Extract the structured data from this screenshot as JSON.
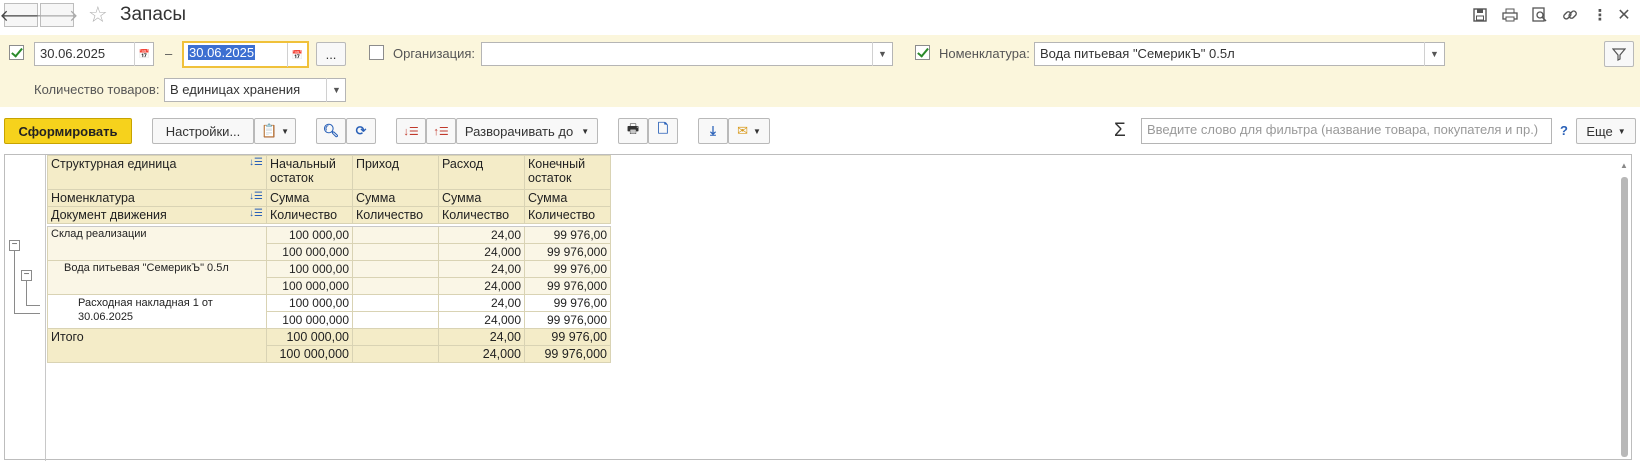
{
  "window": {
    "title": "Запасы",
    "back_icon": "arrow-left-icon",
    "forward_icon": "arrow-right-icon",
    "star_icon": "star-icon"
  },
  "filter": {
    "period_enabled": true,
    "date_from": "30.06.2025",
    "date_to": "30.06.2025",
    "dash": "–",
    "more_label": "...",
    "organization_label": "Организация:",
    "organization_value": "",
    "organization_enabled": false,
    "nomenclature_label": "Номенклатура:",
    "nomenclature_value": "Вода питьевая \"СемерикЪ\" 0.5л",
    "nomenclature_enabled": true,
    "quantity_label": "Количество товаров:",
    "quantity_value": "В единицах хранения"
  },
  "toolbar": {
    "generate_label": "Сформировать",
    "settings_label": "Настройки...",
    "expand_label": "Разворачивать до",
    "sigma": "Σ",
    "search_placeholder": "Введите слово для фильтра (название товара, покупателя и пр.)",
    "help": "?",
    "more_label": "Еще"
  },
  "report": {
    "headers": {
      "col1_row1": "Структурная единица",
      "col1_row2": "Номенклатура",
      "col1_row3": "Документ движения",
      "start_row1": "Начальный остаток",
      "income_row1": "Приход",
      "outcome_row1": "Расход",
      "end_row1": "Конечный остаток",
      "sum": "Сумма",
      "qty": "Количество"
    },
    "rows": [
      {
        "name": "Склад реализации",
        "start_sum": "100 000,00",
        "start_qty": "100 000,000",
        "in_sum": "",
        "in_qty": "",
        "out_sum": "24,00",
        "out_qty": "24,000",
        "end_sum": "99 976,00",
        "end_qty": "99 976,000"
      },
      {
        "name": "Вода питьевая \"СемерикЪ\" 0.5л",
        "start_sum": "100 000,00",
        "start_qty": "100 000,000",
        "in_sum": "",
        "in_qty": "",
        "out_sum": "24,00",
        "out_qty": "24,000",
        "end_sum": "99 976,00",
        "end_qty": "99 976,000"
      },
      {
        "name": "Расходная накладная 1 от",
        "name2": "30.06.2025",
        "start_sum": "100 000,00",
        "start_qty": "100 000,000",
        "in_sum": "",
        "in_qty": "",
        "out_sum": "24,00",
        "out_qty": "24,000",
        "end_sum": "99 976,00",
        "end_qty": "99 976,000"
      }
    ],
    "total": {
      "name": "Итого",
      "start_sum": "100 000,00",
      "start_qty": "100 000,000",
      "out_sum": "24,00",
      "out_qty": "24,000",
      "end_sum": "99 976,00",
      "end_qty": "99 976,000"
    }
  }
}
